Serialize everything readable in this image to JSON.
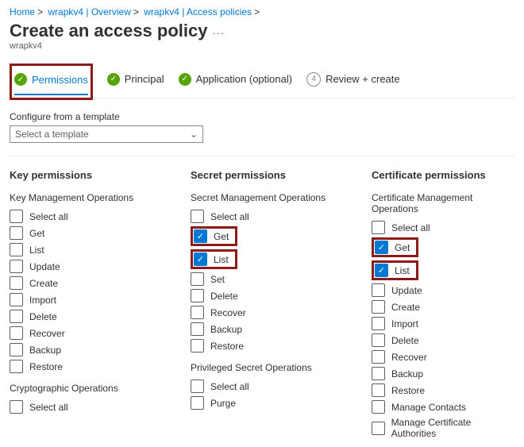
{
  "breadcrumb": {
    "home": "Home",
    "l1": "wrapkv4 | Overview",
    "l2": "wrapkv4 | Access policies"
  },
  "title": "Create an access policy",
  "sub": "wrapkv4",
  "tabs": {
    "permissions": "Permissions",
    "principal": "Principal",
    "application": "Application (optional)",
    "review": "Review + create",
    "reviewnum": "4"
  },
  "template": {
    "label": "Configure from a template",
    "placeholder": "Select a template"
  },
  "keyperm": {
    "heading": "Key permissions",
    "op1": "Key Management Operations",
    "selectall": "Select all",
    "items": [
      "Get",
      "List",
      "Update",
      "Create",
      "Import",
      "Delete",
      "Recover",
      "Backup",
      "Restore"
    ],
    "op2": "Cryptographic Operations",
    "selectall2": "Select all"
  },
  "secretperm": {
    "heading": "Secret permissions",
    "op1": "Secret Management Operations",
    "selectall": "Select all",
    "items": [
      "Get",
      "List",
      "Set",
      "Delete",
      "Recover",
      "Backup",
      "Restore"
    ],
    "op2": "Privileged Secret Operations",
    "selectall2": "Select all",
    "items2": [
      "Purge"
    ]
  },
  "certperm": {
    "heading": "Certificate permissions",
    "op1": "Certificate Management Operations",
    "selectall": "Select all",
    "items": [
      "Get",
      "List",
      "Update",
      "Create",
      "Import",
      "Delete",
      "Recover",
      "Backup",
      "Restore",
      "Manage Contacts",
      "Manage Certificate Authorities"
    ]
  },
  "checked": {
    "secret": [
      "Get",
      "List"
    ],
    "cert": [
      "Get",
      "List"
    ]
  }
}
